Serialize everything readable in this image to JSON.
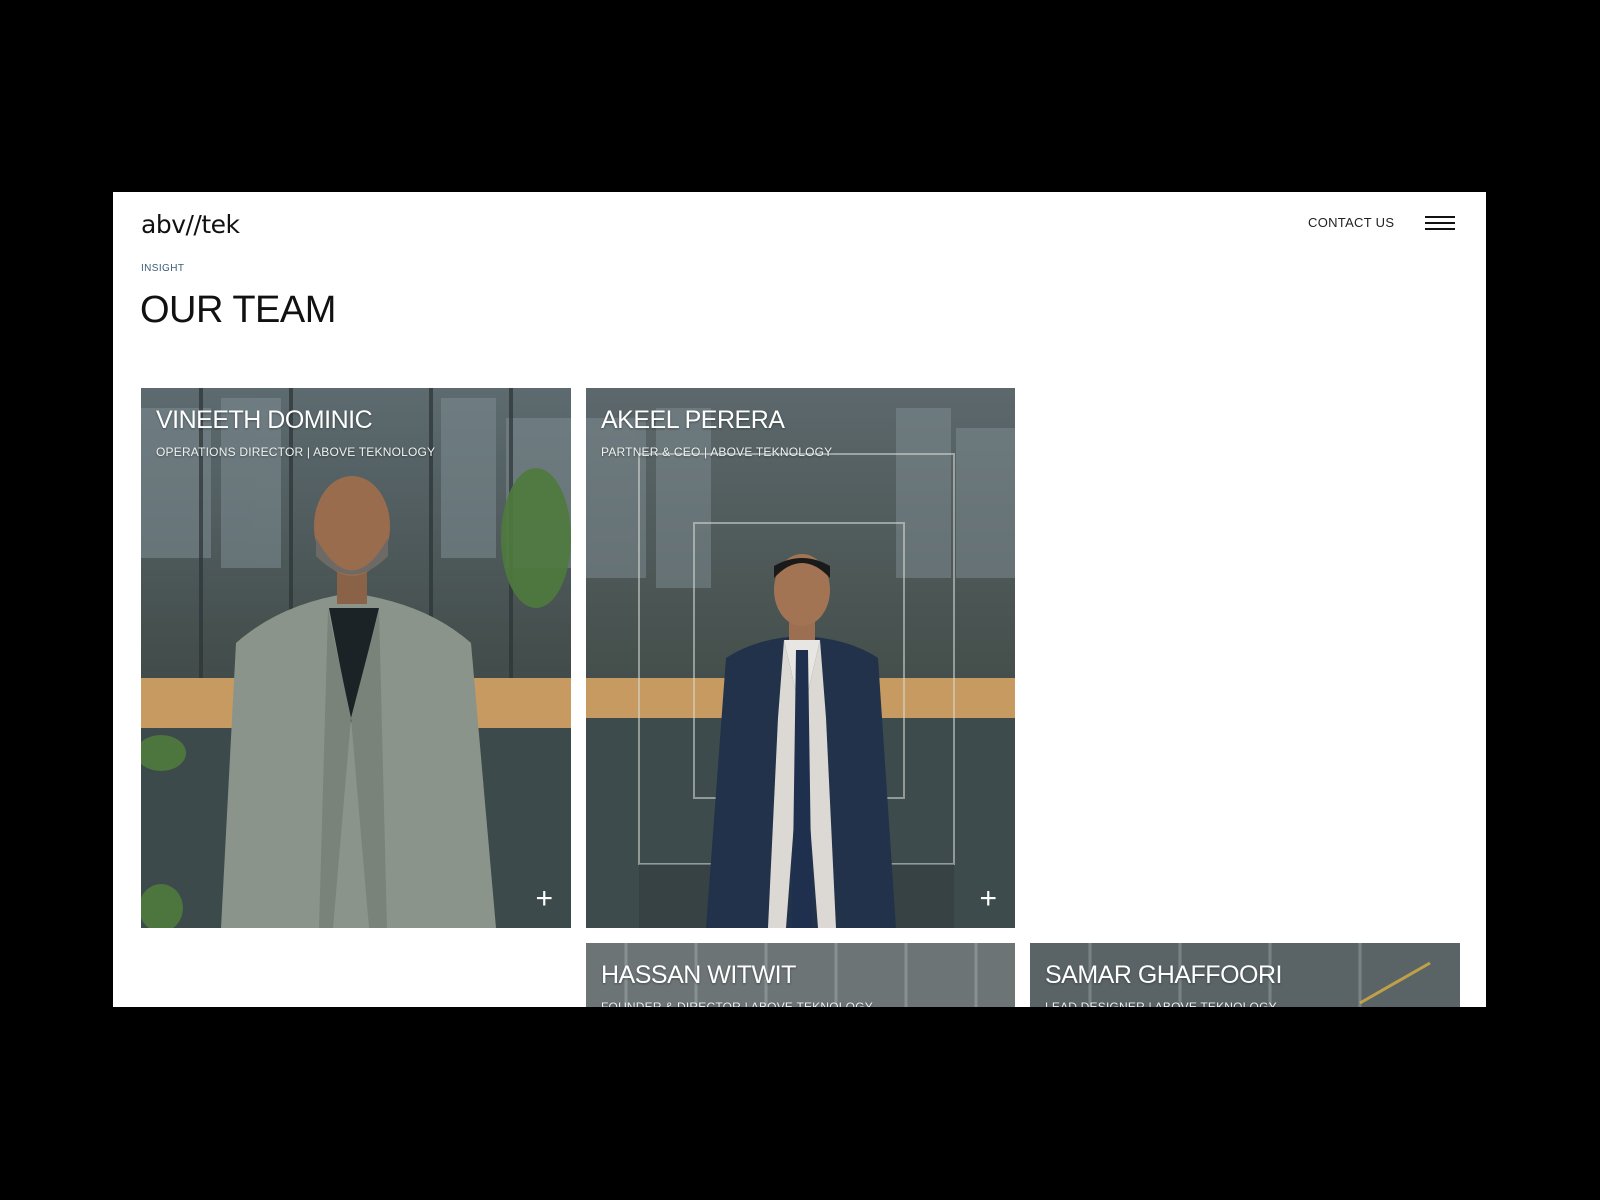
{
  "header": {
    "logo_text": "abv//tek",
    "contact_label": "CONTACT US",
    "menu_icon": "hamburger-menu-icon"
  },
  "section": {
    "eyebrow": "INSIGHT",
    "title": "OUR TEAM"
  },
  "team": [
    {
      "name": "VINEETH DOMINIC",
      "role": "OPERATIONS DIRECTOR | ABOVE TEKNOLOGY",
      "expand_icon": "+"
    },
    {
      "name": "AKEEL PERERA",
      "role": "PARTNER & CEO | ABOVE TEKNOLOGY",
      "expand_icon": "+"
    },
    {
      "name": "HASSAN WITWIT",
      "role": "FOUNDER & DIRECTOR | ABOVE TEKNOLOGY"
    },
    {
      "name": "SAMAR GHAFFOORI",
      "role": "LEAD DESIGNER | ABOVE TEKNOLOGY"
    }
  ],
  "colors": {
    "frame": "#000000",
    "page_bg": "#ffffff",
    "eyebrow": "#3d5b73",
    "text": "#111111"
  }
}
